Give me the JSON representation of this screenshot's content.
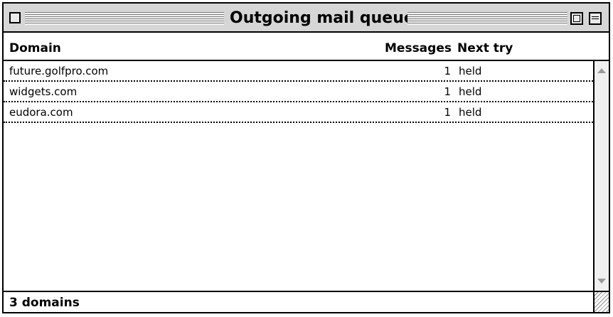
{
  "window": {
    "title": "Outgoing mail queues"
  },
  "table": {
    "headers": {
      "domain": "Domain",
      "messages": "Messages",
      "next_try": "Next try"
    },
    "rows": [
      {
        "domain": "future.golfpro.com",
        "messages": "1",
        "next_try": "held"
      },
      {
        "domain": "widgets.com",
        "messages": "1",
        "next_try": "held"
      },
      {
        "domain": "eudora.com",
        "messages": "1",
        "next_try": "held"
      }
    ]
  },
  "footer": {
    "status": "3 domains"
  },
  "icons": [
    "close-box-icon",
    "zoom-box-icon",
    "collapse-box-icon",
    "scroll-up-arrow-icon",
    "scroll-down-arrow-icon",
    "grow-box-icon"
  ]
}
